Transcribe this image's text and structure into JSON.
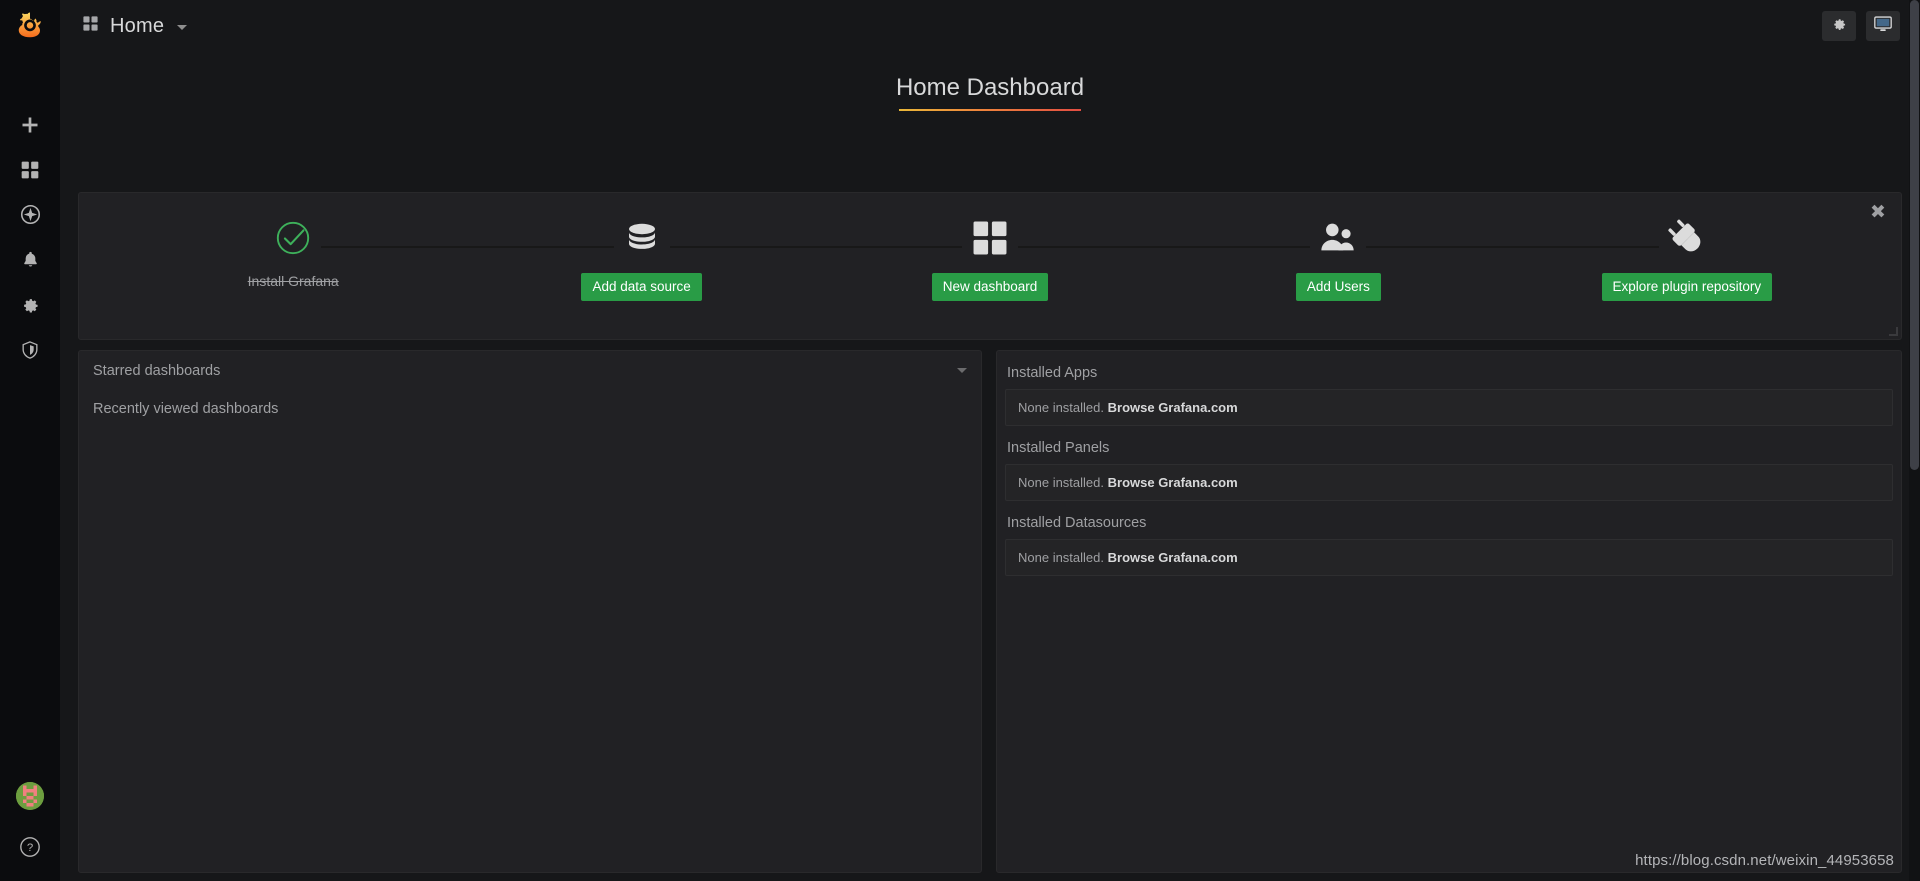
{
  "app": {
    "logo": "grafana-logo-icon",
    "accent_orange": "#eb7b18",
    "accent_green": "#299c46",
    "panel_bg": "#212124",
    "page_bg": "#161719",
    "sidebar_bg": "#0b0c0e"
  },
  "sidebar": {
    "items": [
      {
        "name": "create-add",
        "icon": "plus-icon",
        "label": "Create"
      },
      {
        "name": "dashboards",
        "icon": "dashboards-grid-icon",
        "label": "Dashboards"
      },
      {
        "name": "explore",
        "icon": "compass-icon",
        "label": "Explore"
      },
      {
        "name": "alerting",
        "icon": "bell-icon",
        "label": "Alerting"
      },
      {
        "name": "configuration",
        "icon": "gear-icon",
        "label": "Configuration"
      },
      {
        "name": "server-admin",
        "icon": "shield-icon",
        "label": "Server Admin"
      }
    ],
    "bottom": [
      {
        "name": "user-avatar",
        "icon": "avatar-icon",
        "label": "Profile"
      },
      {
        "name": "help",
        "icon": "question-circle-icon",
        "label": "Help"
      }
    ]
  },
  "topnav": {
    "breadcrumb_icon": "dashboards-grid-icon",
    "breadcrumb_label": "Home",
    "caret": "chevron-down-icon",
    "buttons": [
      {
        "name": "dashboard-settings",
        "icon": "gear-icon"
      },
      {
        "name": "tv-mode",
        "icon": "monitor-icon"
      }
    ]
  },
  "dashboard": {
    "title": "Home Dashboard"
  },
  "getting_started": {
    "close_label": "✖",
    "steps": [
      {
        "icon": "check-circle-icon",
        "state": "done",
        "label": "Install Grafana",
        "button": null
      },
      {
        "icon": "database-icon",
        "state": "todo",
        "label": null,
        "button": "Add data source"
      },
      {
        "icon": "dashboards-grid-icon",
        "state": "todo",
        "label": null,
        "button": "New dashboard"
      },
      {
        "icon": "users-icon",
        "state": "todo",
        "label": null,
        "button": "Add Users"
      },
      {
        "icon": "plug-icon",
        "state": "todo",
        "label": null,
        "button": "Explore plugin repository"
      }
    ]
  },
  "dashboards_panel": {
    "starred_title": "Starred dashboards",
    "starred_caret": "chevron-down-icon",
    "recent_title": "Recently viewed dashboards"
  },
  "plugins_panel": {
    "groups": [
      {
        "heading": "Installed Apps",
        "empty_text": "None installed.",
        "link_text": "Browse Grafana.com"
      },
      {
        "heading": "Installed Panels",
        "empty_text": "None installed.",
        "link_text": "Browse Grafana.com"
      },
      {
        "heading": "Installed Datasources",
        "empty_text": "None installed.",
        "link_text": "Browse Grafana.com"
      }
    ]
  },
  "watermark": {
    "text": "https://blog.csdn.net/weixin_44953658"
  }
}
